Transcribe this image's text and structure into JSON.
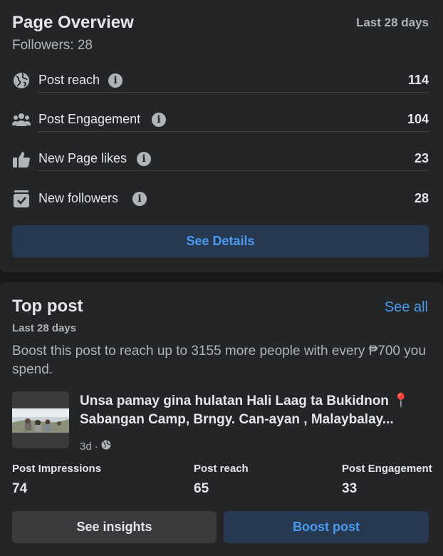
{
  "overview": {
    "title": "Page Overview",
    "range": "Last 28 days",
    "followers": "Followers: 28",
    "metrics": [
      {
        "label": "Post reach",
        "value": "114",
        "icon": "globe-icon"
      },
      {
        "label": "Post Engagement",
        "value": "104",
        "icon": "people-icon"
      },
      {
        "label": "New Page likes",
        "value": "23",
        "icon": "thumbs-up-icon"
      },
      {
        "label": "New followers",
        "value": "28",
        "icon": "follow-box-icon"
      }
    ],
    "info_glyph": "i",
    "see_details": "See Details"
  },
  "top_post": {
    "title": "Top post",
    "see_all": "See all",
    "range": "Last 28 days",
    "boost_text": "Boost this post to reach up to 3155 more people with every ₱700 you spend.",
    "post_text": "Unsa pamay gina hulatan Hali Laag ta Bukidnon 📍 Sabangan Camp, Brngy. Can-ayan , Malaybalay...",
    "age": "3d",
    "separator": "·",
    "privacy_icon": "globe-icon",
    "stats": [
      {
        "label": "Post Impressions",
        "value": "74"
      },
      {
        "label": "Post reach",
        "value": "65"
      },
      {
        "label": "Post Engagement",
        "value": "33"
      }
    ],
    "see_insights": "See insights",
    "boost_post": "Boost post"
  },
  "colors": {
    "background": "#18191a",
    "card": "#242526",
    "accent": "#4a9bf0",
    "button_blue_bg": "#263951",
    "button_gray_bg": "#3a3b3c",
    "text_primary": "#e4e6eb",
    "text_secondary": "#b0b3b8"
  }
}
